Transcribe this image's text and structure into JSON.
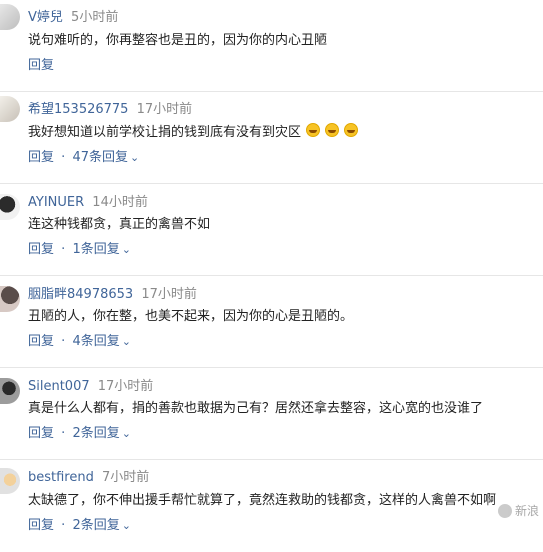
{
  "comments": [
    {
      "username": "V婷兒",
      "time": "5小时前",
      "text": "说句难听的，你再整容也是丑的，因为你的内心丑陋",
      "reply_label": "回复",
      "replies_count": "",
      "avatar": "avatar-1"
    },
    {
      "username": "希望153526775",
      "time": "17小时前",
      "text": "我好想知道以前学校让捐的钱到底有没有到灾区",
      "emoji_count": 3,
      "reply_label": "回复",
      "replies_count": "47条回复",
      "avatar": "avatar-2"
    },
    {
      "username": "AYINUER",
      "time": "14小时前",
      "text": "连这种钱都贪，真正的禽兽不如",
      "reply_label": "回复",
      "replies_count": "1条回复",
      "avatar": "avatar-3"
    },
    {
      "username": "胭脂畔84978653",
      "time": "17小时前",
      "text": "丑陋的人，你在整，也美不起来，因为你的心是丑陋的。",
      "reply_label": "回复",
      "replies_count": "4条回复",
      "avatar": "avatar-4"
    },
    {
      "username": "Silent007",
      "time": "17小时前",
      "text": "真是什么人都有，捐的善款也敢据为己有？居然还拿去整容，这心宽的也没谁了",
      "reply_label": "回复",
      "replies_count": "2条回复",
      "avatar": "avatar-5"
    },
    {
      "username": "bestfirend",
      "time": "7小时前",
      "text": "太缺德了，你不伸出援手帮忙就算了，竟然连救助的钱都贪，这样的人禽兽不如啊",
      "reply_label": "回复",
      "replies_count": "2条回复",
      "avatar": "avatar-6"
    }
  ],
  "watermark": "新浪",
  "colors": {
    "link": "#406599",
    "time": "#8a8a8a",
    "text": "#222222",
    "divider": "#e6e6e6"
  }
}
